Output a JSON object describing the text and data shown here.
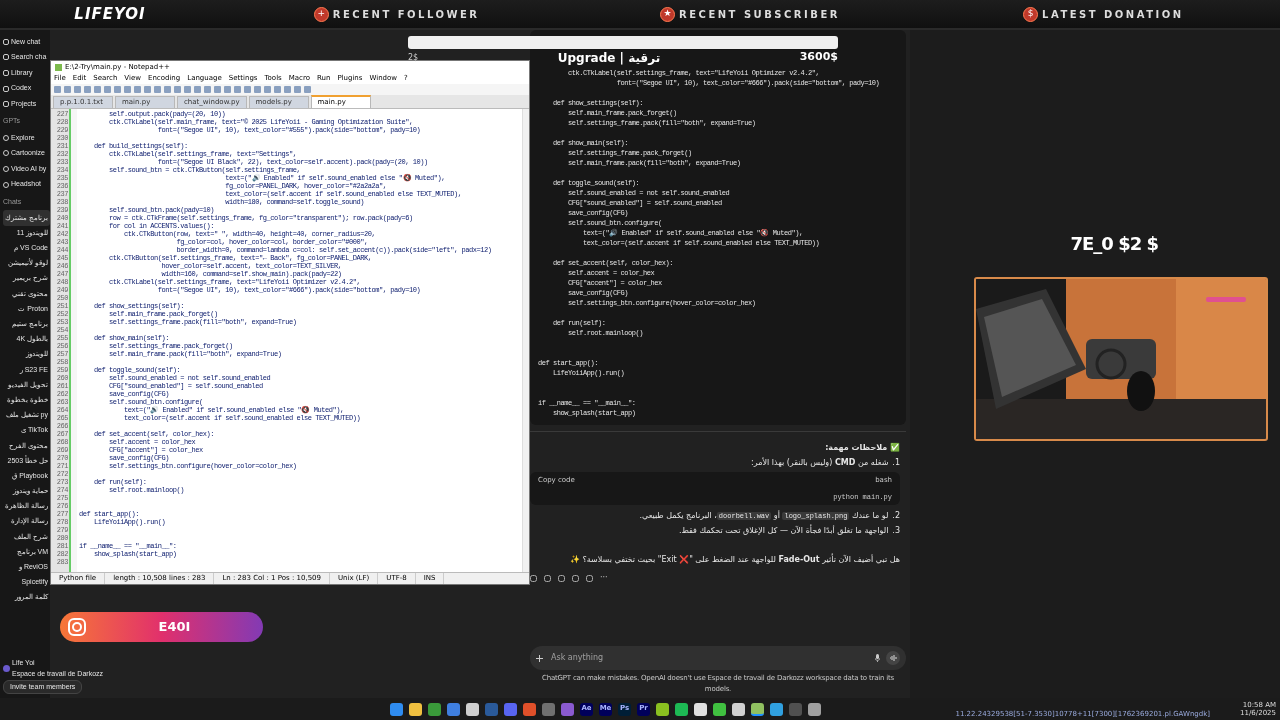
{
  "stream_bar": {
    "logo": "LIFEYOI",
    "widgets": [
      {
        "icon": "+",
        "label": "RECENT FOLLOWER"
      },
      {
        "icon": "★",
        "label": "RECENT SUBSCRIBER"
      },
      {
        "icon": "$",
        "label": "LATEST DONATION"
      }
    ]
  },
  "donation_goal": {
    "current": "2$",
    "title": "Upgrade | ترقية",
    "goal": "3600$",
    "level": 1
  },
  "sidebar": {
    "items": [
      {
        "label": "New chat"
      },
      {
        "label": "Search cha"
      },
      {
        "label": "Library"
      },
      {
        "label": "Codex"
      },
      {
        "label": "Projects"
      }
    ],
    "gpts_heading": "GPTs",
    "gpts": [
      {
        "label": "Explore"
      },
      {
        "label": "Cartoonize"
      },
      {
        "label": "Video AI by"
      },
      {
        "label": "Headshot"
      }
    ],
    "chats_heading": "Chats",
    "chats": [
      {
        "label": "برنامج مشترك",
        "selected": true
      },
      {
        "label": "للويندوز 11",
        "selected": false
      },
      {
        "label": "م VS Code",
        "selected": false
      },
      {
        "label": "لوقو لأنيميشن",
        "selected": false
      },
      {
        "label": "شرح بريمير",
        "selected": false
      },
      {
        "label": "محتوى تقني",
        "selected": false
      },
      {
        "label": "ت Proton",
        "selected": false
      },
      {
        "label": "برنامج ستيم",
        "selected": false
      },
      {
        "label": "4K بالطول",
        "selected": false
      },
      {
        "label": "للويندوز",
        "selected": false
      },
      {
        "label": "ر S23 FE",
        "selected": false
      },
      {
        "label": "تحويل الفيديو",
        "selected": false
      },
      {
        "label": "خطوة بخطوة",
        "selected": false
      },
      {
        "label": "تشغيل ملف py",
        "selected": false
      },
      {
        "label": "ى TikTok",
        "selected": false
      },
      {
        "label": "محتوى الفرح",
        "selected": false
      },
      {
        "label": "حل خطأ 2503",
        "selected": false
      },
      {
        "label": "ق Playbook",
        "selected": false
      },
      {
        "label": "حماية ويندوز",
        "selected": false
      },
      {
        "label": "رسالة الظاهرة",
        "selected": false
      },
      {
        "label": "رسالة الإدارة",
        "selected": false
      },
      {
        "label": "شرح الملف",
        "selected": false
      },
      {
        "label": "برنامج VM",
        "selected": false
      },
      {
        "label": "و ReviOS",
        "selected": false
      },
      {
        "label": "Spicetify",
        "selected": false
      },
      {
        "label": "كلمة المرور",
        "selected": false
      }
    ],
    "user": {
      "name": "Life Yoi",
      "workspace": "Espace de travail de Darkozz"
    },
    "invite_button": "Invite team members"
  },
  "chat": {
    "code_blocks": [
      {
        "kind": "method",
        "lines": [
          "        ctk.CTkLabel(self.settings_frame, text=\"LifeYoii Optimizer v2.4.2\",",
          "                     font=(\"Segoe UI\", 10), text_color=\"#666\").pack(side=\"bottom\", pady=10)"
        ]
      },
      {
        "kind": "method",
        "lines": [
          "    def show_settings(self):",
          "        self.main_frame.pack_forget()",
          "        self.settings_frame.pack(fill=\"both\", expand=True)"
        ]
      },
      {
        "kind": "method",
        "lines": [
          "    def show_main(self):",
          "        self.settings_frame.pack_forget()",
          "        self.main_frame.pack(fill=\"both\", expand=True)"
        ]
      },
      {
        "kind": "method",
        "lines": [
          "    def toggle_sound(self):",
          "        self.sound_enabled = not self.sound_enabled",
          "        CFG[\"sound_enabled\"] = self.sound_enabled",
          "        save_config(CFG)",
          "        self.sound_btn.configure(",
          "            text=(\"🔊 Enabled\" if self.sound_enabled else \"🔇 Muted\"),",
          "            text_color=(self.accent if self.sound_enabled else TEXT_MUTED))"
        ]
      },
      {
        "kind": "method",
        "lines": [
          "    def set_accent(self, color_hex):",
          "        self.accent = color_hex",
          "        CFG[\"accent\"] = color_hex",
          "        save_config(CFG)",
          "        self.settings_btn.configure(hover_color=color_hex)"
        ]
      },
      {
        "kind": "method",
        "lines": [
          "    def run(self):",
          "        self.root.mainloop()"
        ]
      },
      {
        "kind": "function",
        "lines": [
          "def start_app():",
          "    LifeYoiiApp().run()"
        ]
      },
      {
        "kind": "function",
        "lines": [
          "if __name__ == \"__main__\":",
          "    show_splash(start_app)"
        ]
      }
    ],
    "notes_heading": "✅ ملاحظات مهمة:",
    "notes": [
      {
        "number": "1.",
        "segments": [
          {
            "kind": "text",
            "text": "شغله من **CMD** (وليس بالنقر) بهذا الأمر:"
          }
        ]
      },
      {
        "number": "2.",
        "segments": [
          {
            "kind": "text",
            "text": "لو ما عندك "
          },
          {
            "kind": "code",
            "text": "logo_splash.png"
          },
          {
            "kind": "text",
            "text": " أو "
          },
          {
            "kind": "code",
            "text": "doorbell.wav"
          },
          {
            "kind": "text",
            "text": "، البرنامج يكمل طبيعي."
          }
        ]
      },
      {
        "number": "3.",
        "segments": [
          {
            "kind": "text",
            "text": "الواجهة ما تغلق أبدًا فجأة الآن — كل الإغلاق تحت تحكمك فقط."
          }
        ]
      }
    ],
    "snippet": {
      "copy": "Copy code",
      "language": "bash",
      "code": "python main.py"
    },
    "question": "هل تبي أضيف الآن تأثير **Fade-Out** للواجهة عند الضغط على \"❌ Exit\" بحيث تختفي بسلاسة؟ ✨",
    "more": "···",
    "input_placeholder": "Ask anything",
    "disclaimer": "ChatGPT can make mistakes. OpenAI doesn't use Espace de travail de Darkozz workspace data to train its models."
  },
  "overlay": {
    "goal_text": "7E_0 $2 $",
    "instagram": "E40I"
  },
  "notepad": {
    "title": "E:\\2-Try\\main.py - Notepad++",
    "menu": [
      "File",
      "Edit",
      "Search",
      "View",
      "Encoding",
      "Language",
      "Settings",
      "Tools",
      "Macro",
      "Run",
      "Plugins",
      "Window",
      "?"
    ],
    "tabs": [
      {
        "label": "p.p.1.0.1.txt",
        "selected": false
      },
      {
        "label": "main.py",
        "selected": false
      },
      {
        "label": "chat_window.py",
        "selected": false
      },
      {
        "label": "models.py",
        "selected": false
      },
      {
        "label": "main.py",
        "selected": true
      }
    ],
    "lines": [
      {
        "n": "227",
        "code": "        self.output.pack(pady=(20, 10))"
      },
      {
        "n": "228",
        "code": "        ctk.CTkLabel(self.main_frame, text=\"© 2025 LifeYoii - Gaming Optimization Suite\","
      },
      {
        "n": "229",
        "code": "                     font=(\"Segoe UI\", 10), text_color=\"#555\").pack(side=\"bottom\", pady=10)"
      },
      {
        "n": "230"
      },
      {
        "n": "231",
        "code": "    def build_settings(self):"
      },
      {
        "n": "232",
        "code": "        ctk.CTkLabel(self.settings_frame, text=\"Settings\","
      },
      {
        "n": "233",
        "code": "                     font=(\"Segoe UI Black\", 22), text_color=self.accent).pack(pady=(20, 10))"
      },
      {
        "n": "234",
        "code": "        self.sound_btn = ctk.CTkButton(self.settings_frame,"
      },
      {
        "n": "235",
        "code": "                                       text=(\"🔊 Enabled\" if self.sound_enabled else \"🔇 Muted\"),"
      },
      {
        "n": "236",
        "code": "                                       fg_color=PANEL_DARK, hover_color=\"#2a2a2a\","
      },
      {
        "n": "237",
        "code": "                                       text_color=(self.accent if self.sound_enabled else TEXT_MUTED),"
      },
      {
        "n": "238",
        "code": "                                       width=180, command=self.toggle_sound)"
      },
      {
        "n": "239",
        "code": "        self.sound_btn.pack(pady=10)"
      },
      {
        "n": "240",
        "code": "        row = ctk.CTkFrame(self.settings_frame, fg_color=\"transparent\"); row.pack(pady=6)"
      },
      {
        "n": "241",
        "code": "        for col in ACCENTS.values():"
      },
      {
        "n": "242",
        "code": "            ctk.CTkButton(row, text=\" \", width=40, height=40, corner_radius=20,"
      },
      {
        "n": "243",
        "code": "                          fg_color=col, hover_color=col, border_color=\"#000\","
      },
      {
        "n": "244",
        "code": "                          border_width=0, command=lambda c=col: self.set_accent(c)).pack(side=\"left\", padx=12)"
      },
      {
        "n": "245",
        "code": "        ctk.CTkButton(self.settings_frame, text=\"← Back\", fg_color=PANEL_DARK,"
      },
      {
        "n": "246",
        "code": "                      hover_color=self.accent, text_color=TEXT_SILVER,"
      },
      {
        "n": "247",
        "code": "                      width=160, command=self.show_main).pack(pady=22)"
      },
      {
        "n": "248",
        "code": "        ctk.CTkLabel(self.settings_frame, text=\"LifeYoii Optimizer v2.4.2\","
      },
      {
        "n": "249",
        "code": "                     font=(\"Segoe UI\", 10), text_color=\"#666\").pack(side=\"bottom\", pady=10)"
      },
      {
        "n": "250"
      },
      {
        "n": "251",
        "code": "    def show_settings(self):"
      },
      {
        "n": "252",
        "code": "        self.main_frame.pack_forget()"
      },
      {
        "n": "253",
        "code": "        self.settings_frame.pack(fill=\"both\", expand=True)"
      },
      {
        "n": "254"
      },
      {
        "n": "255",
        "code": "    def show_main(self):"
      },
      {
        "n": "256",
        "code": "        self.settings_frame.pack_forget()"
      },
      {
        "n": "257",
        "code": "        self.main_frame.pack(fill=\"both\", expand=True)"
      },
      {
        "n": "258"
      },
      {
        "n": "259",
        "code": "    def toggle_sound(self):"
      },
      {
        "n": "260",
        "code": "        self.sound_enabled = not self.sound_enabled"
      },
      {
        "n": "261",
        "code": "        CFG[\"sound_enabled\"] = self.sound_enabled"
      },
      {
        "n": "262",
        "code": "        save_config(CFG)"
      },
      {
        "n": "263",
        "code": "        self.sound_btn.configure("
      },
      {
        "n": "264",
        "code": "            text=(\"🔊 Enabled\" if self.sound_enabled else \"🔇 Muted\"),"
      },
      {
        "n": "265",
        "code": "            text_color=(self.accent if self.sound_enabled else TEXT_MUTED))"
      },
      {
        "n": "266"
      },
      {
        "n": "267",
        "code": "    def set_accent(self, color_hex):"
      },
      {
        "n": "268",
        "code": "        self.accent = color_hex"
      },
      {
        "n": "269",
        "code": "        CFG[\"accent\"] = color_hex"
      },
      {
        "n": "270",
        "code": "        save_config(CFG)"
      },
      {
        "n": "271",
        "code": "        self.settings_btn.configure(hover_color=color_hex)"
      },
      {
        "n": "272"
      },
      {
        "n": "273",
        "code": "    def run(self):"
      },
      {
        "n": "274",
        "code": "        self.root.mainloop()"
      },
      {
        "n": "275"
      },
      {
        "n": "276"
      },
      {
        "n": "277",
        "code": "def start_app():"
      },
      {
        "n": "278",
        "code": "    LifeYoiiApp().run()"
      },
      {
        "n": "279"
      },
      {
        "n": "280"
      },
      {
        "n": "281",
        "code": "if __name__ == \"__main__\":"
      },
      {
        "n": "282",
        "code": "    show_splash(start_app)"
      },
      {
        "n": "283"
      }
    ],
    "status": [
      "Python file",
      "length : 10,508    lines : 283",
      "Ln : 283    Col : 1    Pos : 10,509",
      "Unix (LF)",
      "UTF-8",
      "INS"
    ]
  },
  "taskbar": {
    "apps": [
      {
        "kind": "tile",
        "color": "#2f8cf0",
        "selected": false
      },
      {
        "kind": "tile",
        "color": "#f0c040",
        "selected": false
      },
      {
        "kind": "tile",
        "color": "#3a9a3a",
        "selected": false
      },
      {
        "kind": "tile",
        "color": "#3f7fe0",
        "selected": false
      },
      {
        "kind": "tile",
        "color": "#cfcfcf",
        "selected": false
      },
      {
        "kind": "tile",
        "color": "#2a5a9a",
        "selected": false
      },
      {
        "kind": "tile",
        "color": "#5865f2",
        "selected": false
      },
      {
        "kind": "tile",
        "color": "#e0502a",
        "selected": false
      },
      {
        "kind": "tile",
        "color": "#707070",
        "selected": false
      },
      {
        "kind": "tile",
        "color": "#8a5ad0",
        "selected": false
      },
      {
        "kind": "glyph",
        "label": "Ae",
        "color": "#00005b",
        "selected": false
      },
      {
        "kind": "glyph",
        "label": "Me",
        "color": "#00005b",
        "selected": false
      },
      {
        "kind": "glyph",
        "label": "Ps",
        "color": "#001e36",
        "selected": false
      },
      {
        "kind": "glyph",
        "label": "Pr",
        "color": "#00005b",
        "selected": false
      },
      {
        "kind": "tile",
        "color": "#8ac020",
        "selected": false
      },
      {
        "kind": "tile",
        "color": "#1db954",
        "selected": false
      },
      {
        "kind": "tile",
        "color": "#e0e0e0",
        "selected": false
      },
      {
        "kind": "tile",
        "color": "#40c040",
        "selected": false
      },
      {
        "kind": "tile",
        "color": "#d0d0d0",
        "selected": false
      },
      {
        "kind": "tile",
        "color": "#90c060",
        "selected": true
      },
      {
        "kind": "tile",
        "color": "#30a0e0",
        "selected": false
      },
      {
        "kind": "tile",
        "color": "#505050",
        "selected": false
      },
      {
        "kind": "tile",
        "color": "#a0a0a0",
        "selected": false
      }
    ],
    "time": "10:58 AM",
    "date": "11/6/2025",
    "stream_stats": "11.22.24329538[51-7.3530]10778+11[7300][1762369201.pl.GAWngdk]"
  }
}
